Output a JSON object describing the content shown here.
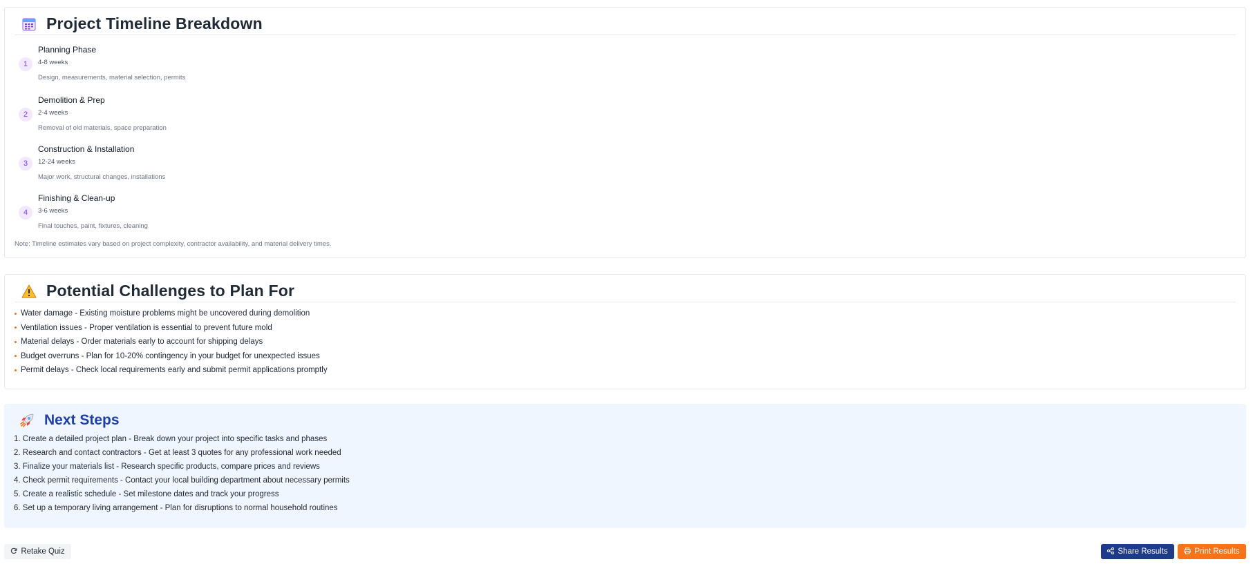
{
  "timeline": {
    "title": "Project Timeline Breakdown",
    "icon": "calendar-icon",
    "phases": [
      {
        "num": "1",
        "name": "Planning Phase",
        "duration": "4-8 weeks",
        "description": "Design, measurements, material selection, permits"
      },
      {
        "num": "2",
        "name": "Demolition & Prep",
        "duration": "2-4 weeks",
        "description": "Removal of old materials, space preparation"
      },
      {
        "num": "3",
        "name": "Construction & Installation",
        "duration": "12-24 weeks",
        "description": "Major work, structural changes, installations"
      },
      {
        "num": "4",
        "name": "Finishing & Clean-up",
        "duration": "3-6 weeks",
        "description": "Final touches, paint, fixtures, cleaning"
      }
    ],
    "note": "Note: Timeline estimates vary based on project complexity, contractor availability, and material delivery times."
  },
  "challenges": {
    "title": "Potential Challenges to Plan For",
    "icon": "warning-icon",
    "items": [
      "Water damage - Existing moisture problems might be uncovered during demolition",
      "Ventilation issues - Proper ventilation is essential to prevent future mold",
      "Material delays - Order materials early to account for shipping delays",
      "Budget overruns - Plan for 10-20% contingency in your budget for unexpected issues",
      "Permit delays - Check local requirements early and submit permit applications promptly"
    ]
  },
  "next_steps": {
    "title": "Next Steps",
    "icon": "rocket-icon",
    "items": [
      "1. Create a detailed project plan - Break down your project into specific tasks and phases",
      "2. Research and contact contractors - Get at least 3 quotes for any professional work needed",
      "3. Finalize your materials list - Research specific products, compare prices and reviews",
      "4. Check permit requirements - Contact your local building department about necessary permits",
      "5. Create a realistic schedule - Set milestone dates and track your progress",
      "6. Set up a temporary living arrangement - Plan for disruptions to normal household routines"
    ]
  },
  "actions": {
    "retake_label": "Retake Quiz",
    "share_label": "Share Results",
    "print_label": "Print Results"
  },
  "colors": {
    "accent_orange": "#f97316",
    "accent_navy": "#1e3a8a",
    "next_steps_bg": "#eff6ff",
    "phase_badge_bg": "#f3e8ff"
  }
}
